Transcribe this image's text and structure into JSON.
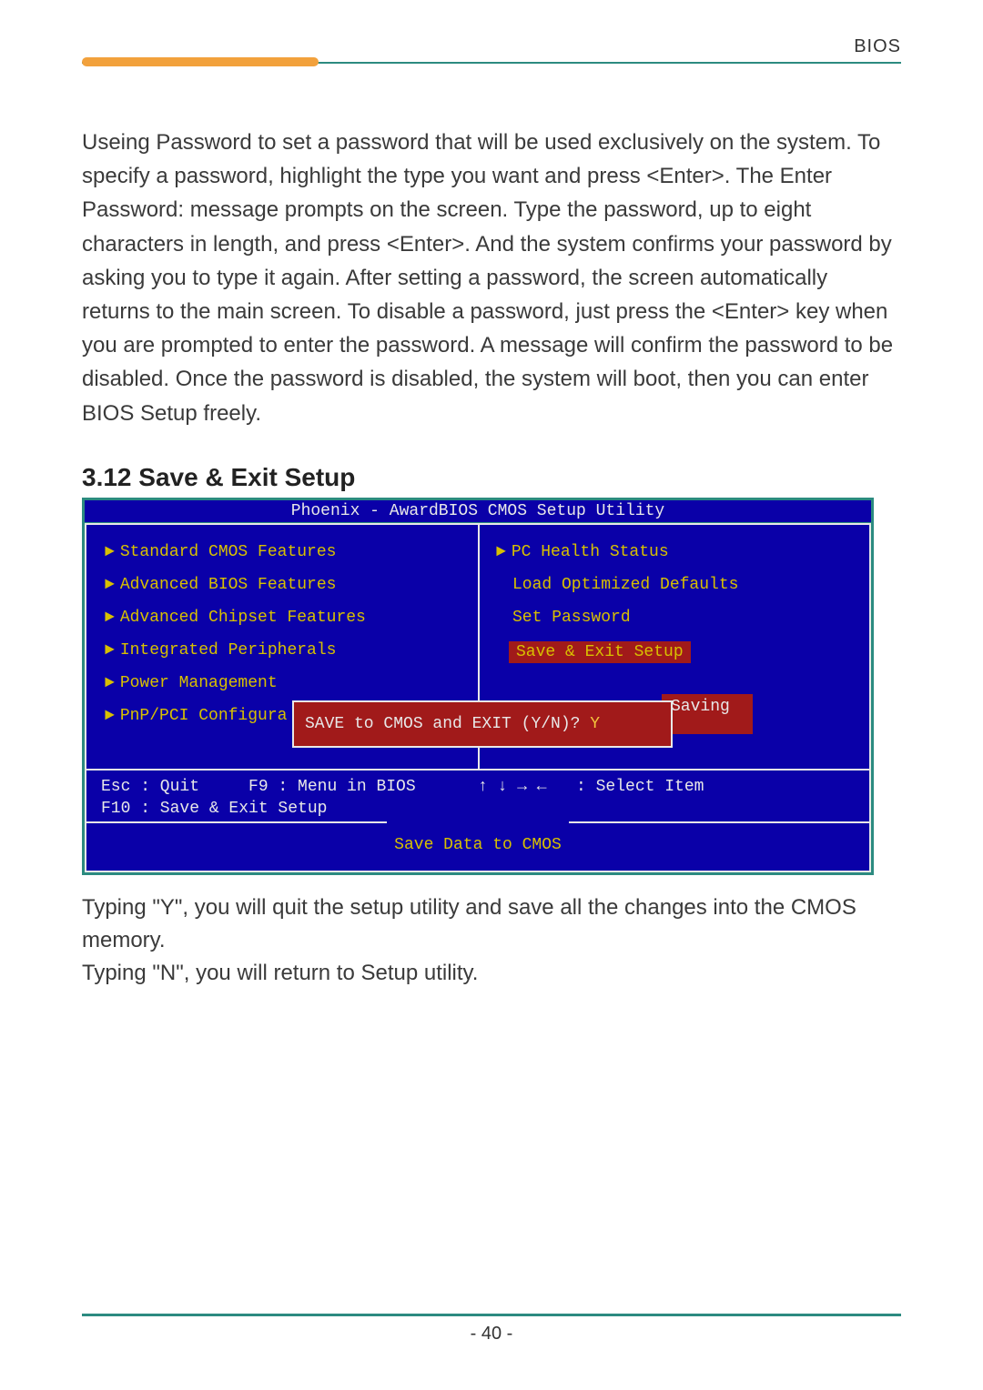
{
  "header": {
    "label": "BIOS"
  },
  "paragraph1": "Useing Password to set a password that will be used exclusively on the system. To specify a password, highlight the type you want and press <Enter>. The Enter Password: message prompts on the screen. Type the password, up to eight characters in length, and press <Enter>. And the system confirms your password by asking you to type it again. After setting a password, the screen automatically returns to the main screen. To disable a password, just press the <Enter> key when you are prompted to enter the password. A message will confirm the password to be disabled. Once the password is disabled, the system will boot, then you can enter BIOS Setup freely.",
  "section_heading": "3.12 Save & Exit Setup",
  "bios": {
    "title": "Phoenix - AwardBIOS CMOS Setup Utility",
    "left_items": [
      "Standard CMOS Features",
      "Advanced BIOS Features",
      "Advanced Chipset Features",
      "Integrated Peripherals",
      "Power Management",
      "PnP/PCI Configura"
    ],
    "right_items": [
      {
        "label": "PC Health Status",
        "arrow": true,
        "selected": false
      },
      {
        "label": "Load Optimized Defaults",
        "arrow": false,
        "selected": false
      },
      {
        "label": "Set Password",
        "arrow": false,
        "selected": false
      },
      {
        "label": "Save & Exit Setup",
        "arrow": false,
        "selected": true
      }
    ],
    "saving_label": "Saving",
    "dialog_prompt": "SAVE to CMOS and EXIT (Y/N)? ",
    "dialog_answer": "Y",
    "keys_left": "Esc : Quit     F9 : Menu in BIOS\nF10 : Save & Exit Setup",
    "keys_right": "↑ ↓ → ←   : Select Item",
    "bottom_cmd": "Save Data to CMOS"
  },
  "paragraph2_line1": "Typing \"Y\", you will quit the setup utility and save all the changes into the CMOS memory.",
  "paragraph2_line2": "Typing \"N\", you will return to Setup utility.",
  "page_number": "- 40 -"
}
